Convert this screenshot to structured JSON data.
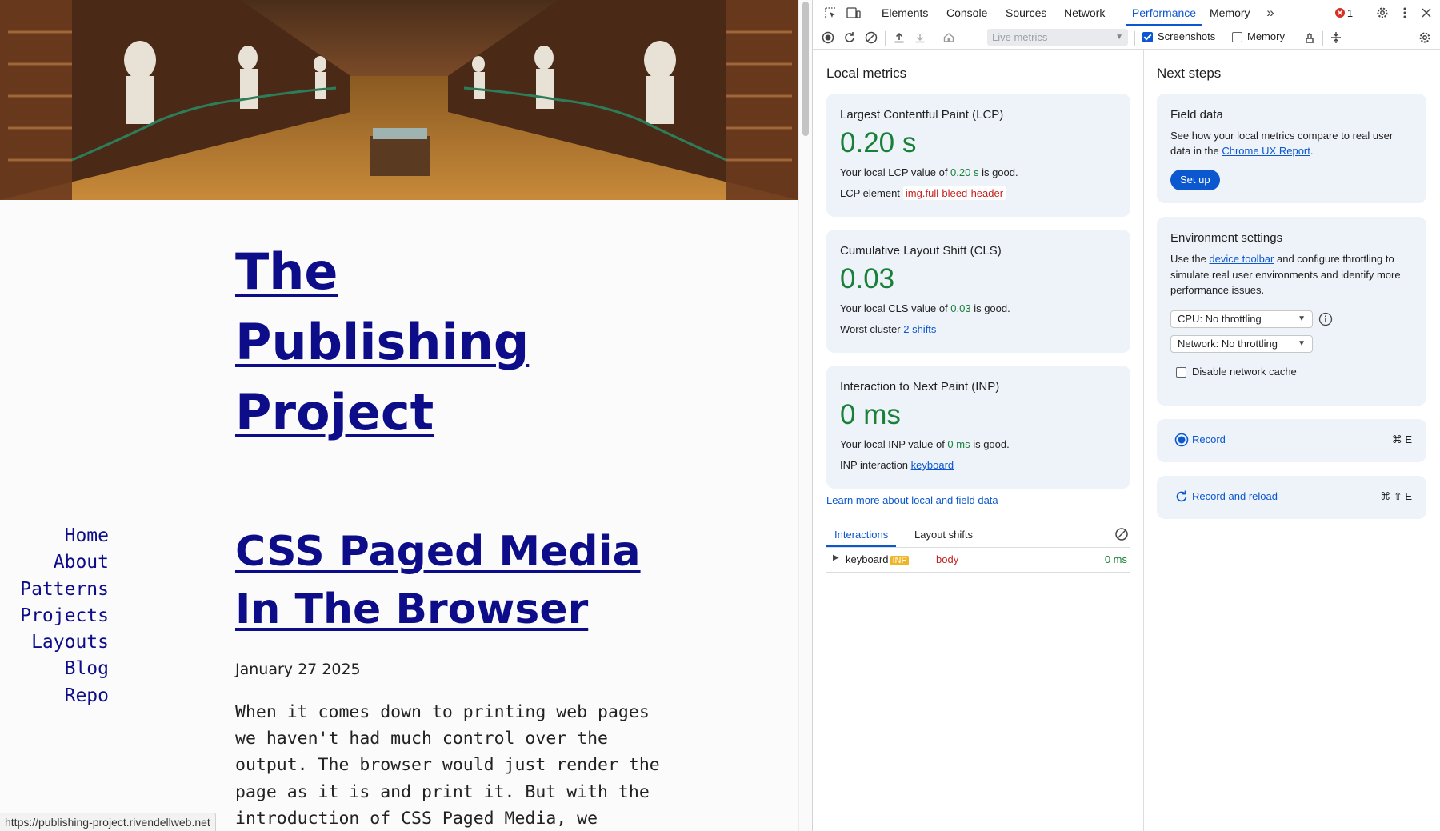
{
  "site": {
    "title": "The Publishing Project",
    "nav": [
      "Home",
      "About",
      "Patterns",
      "Projects",
      "Layouts",
      "Blog",
      "Repo"
    ],
    "post": {
      "title": "CSS Paged Media In The Browser",
      "date": "January 27 2025",
      "excerpt": "When it comes down to printing web pages we haven't had much control over the output. The browser would just render the page as it is and print it. But with the introduction of CSS Paged Media, we can..."
    },
    "status_url": "https://publishing-project.rivendellweb.net"
  },
  "devtools": {
    "tabs": [
      "Elements",
      "Console",
      "Sources",
      "Network",
      "Performance",
      "Memory"
    ],
    "active_tab": "Performance",
    "error_count": "1",
    "toolbar": {
      "live_select": "Live metrics",
      "screenshots_label": "Screenshots",
      "memory_label": "Memory",
      "screenshots_checked": true,
      "memory_checked": false
    },
    "local": {
      "heading": "Local metrics",
      "lcp": {
        "title": "Largest Contentful Paint (LCP)",
        "value": "0.20 s",
        "text_pre": "Your local LCP value of ",
        "text_val": "0.20 s",
        "text_post": " is good.",
        "sub_label": "LCP element",
        "sub_value": "img.full-bleed-header"
      },
      "cls": {
        "title": "Cumulative Layout Shift (CLS)",
        "value": "0.03",
        "text_pre": "Your local CLS value of ",
        "text_val": "0.03",
        "text_post": " is good.",
        "sub_label": "Worst cluster",
        "sub_value": "2 shifts"
      },
      "inp": {
        "title": "Interaction to Next Paint (INP)",
        "value": "0 ms",
        "text_pre": "Your local INP value of ",
        "text_val": "0 ms",
        "text_post": " is good.",
        "sub_label": "INP interaction",
        "sub_value": "keyboard"
      },
      "learn_more": "Learn more about local and field data",
      "subtabs": [
        "Interactions",
        "Layout shifts"
      ],
      "interaction": {
        "type": "keyboard",
        "badge": "INP",
        "target": "body",
        "time": "0 ms"
      }
    },
    "next": {
      "heading": "Next steps",
      "field": {
        "title": "Field data",
        "text_pre": "See how your local metrics compare to real user data in the ",
        "link": "Chrome UX Report",
        "text_post": ".",
        "button": "Set up"
      },
      "env": {
        "title": "Environment settings",
        "text_pre": "Use the ",
        "link": "device toolbar",
        "text_post": " and configure throttling to simulate real user environments and identify more performance issues.",
        "cpu": "CPU: No throttling",
        "network": "Network: No throttling",
        "cache_label": "Disable network cache"
      },
      "record": {
        "label": "Record",
        "shortcut": "⌘ E"
      },
      "record_reload": {
        "label": "Record and reload",
        "shortcut": "⌘ ⇧ E"
      }
    },
    "colors": {
      "accent": "#0b57d0",
      "good": "#188038",
      "link_dark": "#0d0d8a"
    }
  }
}
